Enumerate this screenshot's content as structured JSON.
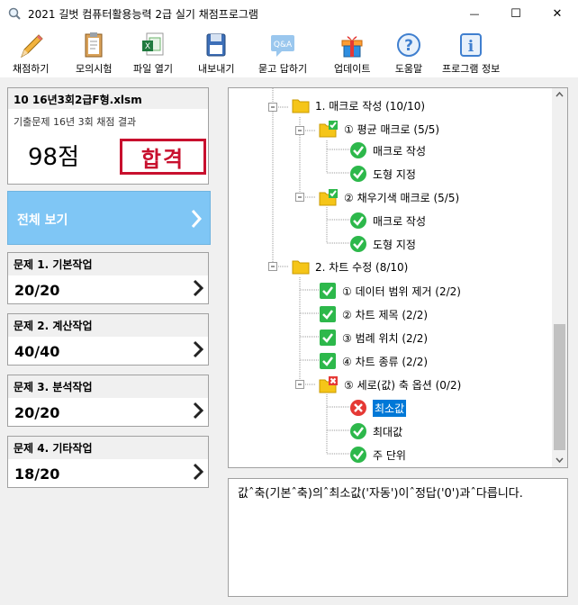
{
  "window": {
    "title": "2021 길벗 컴퓨터활용능력 2급 실기 채점프로그램",
    "minimize_glyph": "—",
    "maximize_glyph": "☐",
    "close_glyph": "✕"
  },
  "toolbar": {
    "grade": "채점하기",
    "mock": "모의시험",
    "open": "파일 열기",
    "export": "내보내기",
    "qa": "묻고 답하기",
    "qa_icon_text": "Q&A",
    "update": "업데이트",
    "help": "도움말",
    "help_icon_text": "?",
    "info": "프로그램 정보",
    "info_icon_text": "i"
  },
  "file": {
    "name": "10 16년3회2급F형.xlsm",
    "desc": "기출문제 16년 3회 채점 결과",
    "score": "98점",
    "stamp": "합격"
  },
  "all_view": "전체 보기",
  "questions": [
    {
      "title": "문제 1. 기본작업",
      "score": "20/20"
    },
    {
      "title": "문제 2. 계산작업",
      "score": "40/40"
    },
    {
      "title": "문제 3. 분석작업",
      "score": "20/20"
    },
    {
      "title": "문제 4. 기타작업",
      "score": "18/20"
    }
  ],
  "tree": [
    {
      "label": "1. 매크로 작성 (10/10)"
    },
    {
      "label": "① 평균 매크로 (5/5)"
    },
    {
      "label": "매크로 작성"
    },
    {
      "label": "도형 지정"
    },
    {
      "label": "② 채우기색 매크로 (5/5)"
    },
    {
      "label": "매크로 작성"
    },
    {
      "label": "도형 지정"
    },
    {
      "label": "2. 차트 수정 (8/10)"
    },
    {
      "label": "① 데이터 범위 제거 (2/2)"
    },
    {
      "label": "② 차트 제목 (2/2)"
    },
    {
      "label": "③ 범례 위치 (2/2)"
    },
    {
      "label": "④ 차트 종류 (2/2)"
    },
    {
      "label": "⑤ 세로(값) 축 옵션 (0/2)"
    },
    {
      "label": "최소값"
    },
    {
      "label": "최대값"
    },
    {
      "label": "주 단위"
    }
  ],
  "description": "값ˆ축(기본ˆ축)의ˆ최소값('자동')이ˆ정답('0')과ˆ다릅니다.",
  "colors": {
    "accent": "#7fc6f5",
    "selected": "#0078d7",
    "ok": "#2db84b",
    "fail": "#e53935",
    "folder": "#f5c518",
    "stamp": "#c8102e"
  }
}
